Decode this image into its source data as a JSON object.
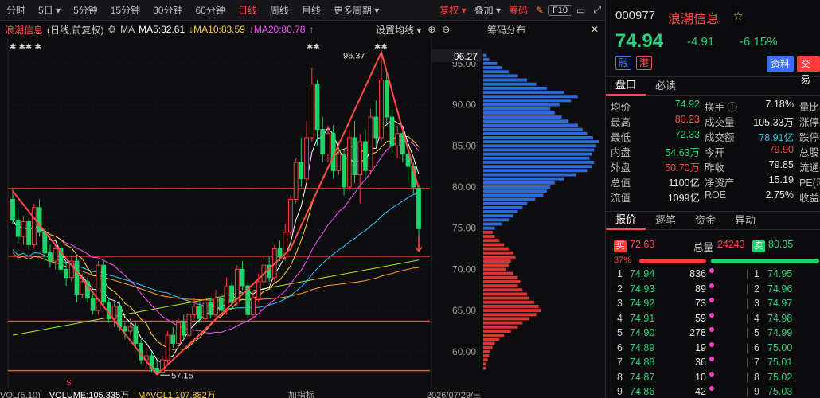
{
  "periodbar": {
    "periods": [
      "分时",
      "5日 ▾",
      "5分钟",
      "15分钟",
      "30分钟",
      "60分钟",
      "日线",
      "周线",
      "月线",
      "更多周期 ▾"
    ],
    "active_index": 6,
    "right": {
      "fuquan": "复权 ▾",
      "overlay": "叠加 ▾",
      "chips": "筹码",
      "f10": "F10"
    }
  },
  "chart": {
    "title": "浪潮信息",
    "subtitle": "(日线,前复权)",
    "ma_label": "MA",
    "ma5": "MA5:82.61",
    "ma10": "MA10:83.59",
    "ma20": "MA20:80.78",
    "arrow_down": "↓",
    "arrow_up": "↑",
    "settings": "设置均线 ▾",
    "chips_title": "筹码分布",
    "high_label": "96.37",
    "low_label": "57.15",
    "current_price_label": "96.27",
    "s_marker": "S",
    "star_marks": [
      "✱ ✱✱ ✱",
      "✱✱",
      "✱✱"
    ],
    "colors": {
      "up": "#ff3b3b",
      "down": "#1fd26b",
      "ma5": "#ffffff",
      "ma10": "#ffd23f",
      "ma20": "#ff4fff",
      "ma30": "#25c8ff",
      "ma60": "#ff9a2e",
      "ma120": "#b2e61c"
    }
  },
  "volbar": {
    "vol": "VOL(5,10)",
    "volume": "VOLUME:105.335万",
    "mavol1": "MAVOL1:107.882万",
    "indicator": "加指标",
    "date": "2026/07/29/三"
  },
  "quote": {
    "code": "000977",
    "name": "浪潮信息",
    "price": "74.94",
    "change": "-4.91",
    "pct": "-6.15%",
    "tag1": "融",
    "tag2": "港",
    "btn_info": "资料",
    "btn_trade": "交易"
  },
  "tabs1": [
    "盘口",
    "必读"
  ],
  "stats": [
    {
      "l1": "均价",
      "v1": "74.92",
      "c1": "grn",
      "l2": "换手 ⓘ",
      "v2": "7.18%",
      "c2": "w",
      "l3": "量比"
    },
    {
      "l1": "最高",
      "v1": "80.23",
      "c1": "red",
      "l2": "成交量",
      "v2": "105.33万",
      "c2": "w",
      "l3": "涨停"
    },
    {
      "l1": "最低",
      "v1": "72.33",
      "c1": "grn",
      "l2": "成交额",
      "v2": "78.91亿",
      "c2": "cyan",
      "l3": "跌停"
    },
    {
      "l1": "内盘",
      "v1": "54.63万",
      "c1": "grn",
      "l2": "今开",
      "v2": "79.90",
      "c2": "red",
      "l3": "总股"
    },
    {
      "l1": "外盘",
      "v1": "50.70万",
      "c1": "red",
      "l2": "昨收",
      "v2": "79.85",
      "c2": "w",
      "l3": "流通"
    },
    {
      "l1": "总值",
      "v1": "1100亿",
      "c1": "w",
      "l2": "净资产",
      "v2": "15.19",
      "c2": "w",
      "l3": "PE(动"
    },
    {
      "l1": "流值",
      "v1": "1099亿",
      "c1": "w",
      "l2": "ROE",
      "v2": "2.75%",
      "c2": "w",
      "l3": "收益"
    }
  ],
  "tabs2": [
    "报价",
    "逐笔",
    "资金",
    "异动"
  ],
  "book": {
    "buy_label": "买",
    "buy_price": "72.63",
    "total_label": "总量",
    "total": "24243",
    "sell_label": "卖",
    "sell_price": "80.35",
    "ratio": "37%",
    "buy_ratio": 0.37,
    "bids": [
      {
        "n": "1",
        "p": "74.94",
        "q": "836"
      },
      {
        "n": "2",
        "p": "74.93",
        "q": "89"
      },
      {
        "n": "3",
        "p": "74.92",
        "q": "73"
      },
      {
        "n": "4",
        "p": "74.91",
        "q": "59"
      },
      {
        "n": "5",
        "p": "74.90",
        "q": "278"
      },
      {
        "n": "6",
        "p": "74.89",
        "q": "19"
      },
      {
        "n": "7",
        "p": "74.88",
        "q": "36"
      },
      {
        "n": "8",
        "p": "74.87",
        "q": "10"
      },
      {
        "n": "9",
        "p": "74.86",
        "q": "42"
      }
    ],
    "asks": [
      {
        "n": "1",
        "p": "74.95"
      },
      {
        "n": "2",
        "p": "74.96"
      },
      {
        "n": "3",
        "p": "74.97"
      },
      {
        "n": "4",
        "p": "74.98"
      },
      {
        "n": "5",
        "p": "74.99"
      },
      {
        "n": "6",
        "p": "75.00"
      },
      {
        "n": "7",
        "p": "75.01"
      },
      {
        "n": "8",
        "p": "75.02"
      },
      {
        "n": "9",
        "p": "75.03"
      }
    ]
  },
  "chart_data": {
    "type": "candlestick",
    "y_ticks": [
      95,
      90,
      85,
      80,
      75,
      70,
      65,
      60
    ],
    "y_tick_labels": [
      "95.00",
      "90.00",
      "85.00",
      "80.00",
      "75.00",
      "70.00",
      "65.00",
      "60.00"
    ],
    "ylim": [
      56.5,
      97.5
    ],
    "support_lines": [
      79.8,
      71.6,
      63.7,
      57.7
    ],
    "candles": [
      [
        78.5,
        76.0,
        79.8,
        75.5
      ],
      [
        76.0,
        74.0,
        77.5,
        73.2
      ],
      [
        74.0,
        75.8,
        76.5,
        73.0
      ],
      [
        75.8,
        73.0,
        76.2,
        72.4
      ],
      [
        73.0,
        77.5,
        78.0,
        72.5
      ],
      [
        77.5,
        74.5,
        78.5,
        74.0
      ],
      [
        74.5,
        72.0,
        75.0,
        71.0
      ],
      [
        72.0,
        71.0,
        73.0,
        70.2
      ],
      [
        71.0,
        72.5,
        73.0,
        70.0
      ],
      [
        72.5,
        70.0,
        73.0,
        69.5
      ],
      [
        70.0,
        69.0,
        71.0,
        68.0
      ],
      [
        69.0,
        71.0,
        71.5,
        68.5
      ],
      [
        71.0,
        67.0,
        71.5,
        66.0
      ],
      [
        67.0,
        68.5,
        69.5,
        66.5
      ],
      [
        68.5,
        66.5,
        69.0,
        66.0
      ],
      [
        66.5,
        65.0,
        67.0,
        64.5
      ],
      [
        65.0,
        70.5,
        71.0,
        64.5
      ],
      [
        70.5,
        66.0,
        71.0,
        65.5
      ],
      [
        66.0,
        64.0,
        66.5,
        63.5
      ],
      [
        64.0,
        65.5,
        66.0,
        63.0
      ],
      [
        65.5,
        63.0,
        66.0,
        62.5
      ],
      [
        63.0,
        62.5,
        63.5,
        61.5
      ],
      [
        62.5,
        63.0,
        64.0,
        62.0
      ],
      [
        63.0,
        61.0,
        63.5,
        60.5
      ],
      [
        61.0,
        59.0,
        61.5,
        58.5
      ],
      [
        59.0,
        59.5,
        60.5,
        58.0
      ],
      [
        59.5,
        58.0,
        60.0,
        57.5
      ],
      [
        58.0,
        57.5,
        59.0,
        57.15
      ],
      [
        57.5,
        59.0,
        59.5,
        57.3
      ],
      [
        59.0,
        62.0,
        62.5,
        58.5
      ],
      [
        62.0,
        61.0,
        63.0,
        60.5
      ],
      [
        61.0,
        63.5,
        64.0,
        60.5
      ],
      [
        63.5,
        62.0,
        64.5,
        61.5
      ],
      [
        62.0,
        64.5,
        65.0,
        61.5
      ],
      [
        64.5,
        65.5,
        66.5,
        64.0
      ],
      [
        65.5,
        64.0,
        66.0,
        63.5
      ],
      [
        64.0,
        66.0,
        67.0,
        63.5
      ],
      [
        66.0,
        64.5,
        66.5,
        64.0
      ],
      [
        64.5,
        66.5,
        67.5,
        64.0
      ],
      [
        66.5,
        65.0,
        67.0,
        64.5
      ],
      [
        65.0,
        68.0,
        69.0,
        64.5
      ],
      [
        68.0,
        66.0,
        68.5,
        65.0
      ],
      [
        66.0,
        70.0,
        70.5,
        65.5
      ],
      [
        70.0,
        68.0,
        71.0,
        67.5
      ],
      [
        68.0,
        64.5,
        68.5,
        64.0
      ],
      [
        64.5,
        66.5,
        67.5,
        64.0
      ],
      [
        66.5,
        68.5,
        69.5,
        66.0
      ],
      [
        68.5,
        70.5,
        71.5,
        68.0
      ],
      [
        70.5,
        69.0,
        71.5,
        68.5
      ],
      [
        69.0,
        72.5,
        73.0,
        68.5
      ],
      [
        72.5,
        71.5,
        73.5,
        71.0
      ],
      [
        71.5,
        74.5,
        75.5,
        71.0
      ],
      [
        74.5,
        78.5,
        79.0,
        74.0
      ],
      [
        78.5,
        83.0,
        83.5,
        78.0
      ],
      [
        83.0,
        81.0,
        86.0,
        80.0
      ],
      [
        81.0,
        86.0,
        88.0,
        80.5
      ],
      [
        86.0,
        92.5,
        94.5,
        85.5
      ],
      [
        92.5,
        87.0,
        93.0,
        85.0
      ],
      [
        87.0,
        84.0,
        88.5,
        83.0
      ],
      [
        84.0,
        86.5,
        87.5,
        83.0
      ],
      [
        86.5,
        82.0,
        87.5,
        81.0
      ],
      [
        82.0,
        84.0,
        85.5,
        81.5
      ],
      [
        84.0,
        80.0,
        84.5,
        79.0
      ],
      [
        80.0,
        86.0,
        87.0,
        79.5
      ],
      [
        86.0,
        81.5,
        88.0,
        80.5
      ],
      [
        81.5,
        85.5,
        86.5,
        78.0
      ],
      [
        85.5,
        82.0,
        87.0,
        81.0
      ],
      [
        82.0,
        88.5,
        89.5,
        81.5
      ],
      [
        88.5,
        86.0,
        90.5,
        85.0
      ],
      [
        86.0,
        93.0,
        96.37,
        85.5
      ],
      [
        93.0,
        88.5,
        94.0,
        87.5
      ],
      [
        88.5,
        85.0,
        89.5,
        84.0
      ],
      [
        85.0,
        86.5,
        87.5,
        83.5
      ],
      [
        86.5,
        84.0,
        87.0,
        83.0
      ],
      [
        84.0,
        82.5,
        85.0,
        80.5
      ],
      [
        82.5,
        80.0,
        83.0,
        79.2
      ],
      [
        79.85,
        74.94,
        80.23,
        72.33
      ]
    ],
    "trend_lines": [
      [
        [
          0,
          79.5
        ],
        [
          11,
          70.5
        ],
        [
          27,
          57.2
        ]
      ],
      [
        [
          27,
          57.2
        ],
        [
          52,
          72.5
        ],
        [
          69,
          96.37
        ],
        [
          76,
          79.8
        ]
      ]
    ],
    "chips": {
      "price_step": 0.5,
      "buckets": [
        [
          96.0,
          0.03
        ],
        [
          95.5,
          0.05
        ],
        [
          95.0,
          0.12
        ],
        [
          94.5,
          0.16
        ],
        [
          94.0,
          0.22
        ],
        [
          93.5,
          0.3
        ],
        [
          93.0,
          0.38
        ],
        [
          92.5,
          0.46
        ],
        [
          92.0,
          0.55
        ],
        [
          91.5,
          0.7
        ],
        [
          91.0,
          0.82
        ],
        [
          90.5,
          0.76
        ],
        [
          90.0,
          0.66
        ],
        [
          89.5,
          0.58
        ],
        [
          89.0,
          0.62
        ],
        [
          88.5,
          0.68
        ],
        [
          88.0,
          0.74
        ],
        [
          87.5,
          0.82
        ],
        [
          87.0,
          0.86
        ],
        [
          86.5,
          0.9
        ],
        [
          86.0,
          0.95
        ],
        [
          85.5,
          1.0
        ],
        [
          85.0,
          0.98
        ],
        [
          84.5,
          0.96
        ],
        [
          84.0,
          0.94
        ],
        [
          83.5,
          0.92
        ],
        [
          83.0,
          0.96
        ],
        [
          82.5,
          0.94
        ],
        [
          82.0,
          0.9
        ],
        [
          81.5,
          0.8
        ],
        [
          81.0,
          0.7
        ],
        [
          80.5,
          0.62
        ],
        [
          80.0,
          0.58
        ],
        [
          79.5,
          0.55
        ],
        [
          79.0,
          0.52
        ],
        [
          78.5,
          0.45
        ],
        [
          78.0,
          0.38
        ],
        [
          77.5,
          0.34
        ],
        [
          77.0,
          0.3
        ],
        [
          76.5,
          0.26
        ],
        [
          76.0,
          0.22
        ],
        [
          75.5,
          0.16
        ],
        [
          75.0,
          0.1
        ],
        [
          74.5,
          0.08
        ],
        [
          74.0,
          0.1
        ],
        [
          73.5,
          0.14
        ],
        [
          73.0,
          0.18
        ],
        [
          72.5,
          0.22
        ],
        [
          72.0,
          0.26
        ],
        [
          71.5,
          0.28
        ],
        [
          71.0,
          0.24
        ],
        [
          70.5,
          0.22
        ],
        [
          70.0,
          0.2
        ],
        [
          69.5,
          0.26
        ],
        [
          69.0,
          0.3
        ],
        [
          68.5,
          0.32
        ],
        [
          68.0,
          0.3
        ],
        [
          67.5,
          0.34
        ],
        [
          67.0,
          0.38
        ],
        [
          66.5,
          0.4
        ],
        [
          66.0,
          0.44
        ],
        [
          65.5,
          0.48
        ],
        [
          65.0,
          0.5
        ],
        [
          64.5,
          0.46
        ],
        [
          64.0,
          0.4
        ],
        [
          63.5,
          0.34
        ],
        [
          63.0,
          0.3
        ],
        [
          62.5,
          0.24
        ],
        [
          62.0,
          0.18
        ],
        [
          61.5,
          0.14
        ],
        [
          61.0,
          0.1
        ],
        [
          60.5,
          0.08
        ],
        [
          60.0,
          0.06
        ],
        [
          59.5,
          0.05
        ],
        [
          59.0,
          0.04
        ],
        [
          58.5,
          0.03
        ],
        [
          58.0,
          0.02
        ]
      ]
    }
  }
}
